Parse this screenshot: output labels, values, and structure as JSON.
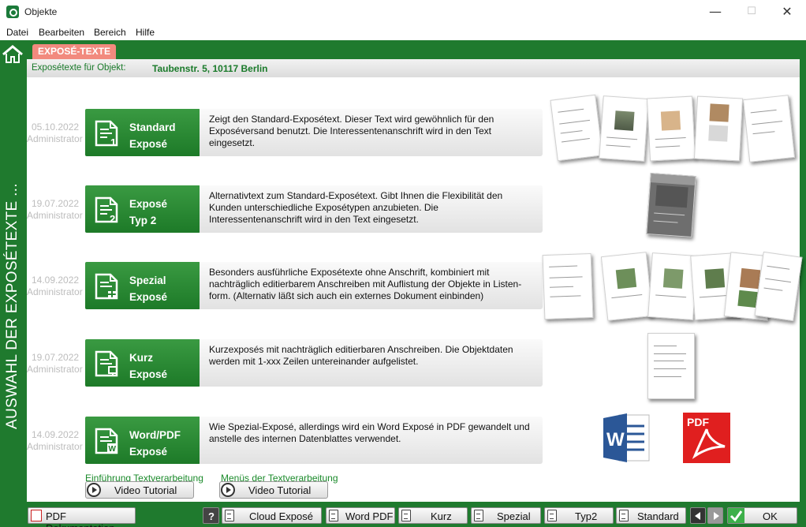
{
  "window": {
    "title": "Objekte"
  },
  "menu": [
    "Datei",
    "Bearbeiten",
    "Bereich",
    "Hilfe"
  ],
  "sidebar": {
    "vertical_title": "AUSWAHL DER EXPOSÉTEXTE ..."
  },
  "tab": {
    "label": "EXPOSÉ-TEXTE"
  },
  "object": {
    "label": "Exposétexte für Objekt:",
    "address": "Taubenstr. 5, 10117 Berlin"
  },
  "rows": [
    {
      "date": "05.10.2022",
      "user": "Administrator",
      "line1": "Standard",
      "line2": "Exposé",
      "description": "Zeigt den Standard-Exposétext. Dieser Text wird gewöhnlich für den Exposéversand benutzt. Die Interessentenanschrift wird in den Text eingesetzt.",
      "icon": "document-1-icon"
    },
    {
      "date": "19.07.2022",
      "user": "Administrator",
      "line1": "Exposé",
      "line2": "Typ 2",
      "description": "Alternativtext zum Standard-Exposétext. Gibt Ihnen die Flexibilität den Kunden unterschiedliche Exposétypen anzubieten. Die Interessentenanschrift wird in den Text eingesetzt.",
      "icon": "document-2-icon"
    },
    {
      "date": "14.09.2022",
      "user": "Administrator",
      "line1": "Spezial",
      "line2": "Exposé",
      "description": "Besonders ausführliche Exposétexte ohne Anschrift, kombiniert mit nachträglich editierbarem Anschreiben mit Auflistung der Objekte in Listen-form. (Alternativ läßt sich auch ein externes Dokument einbinden)",
      "icon": "document-list-icon"
    },
    {
      "date": "19.07.2022",
      "user": "Administrator",
      "line1": "Kurz",
      "line2": "Exposé",
      "description": "Kurzexposés mit nachträglich editierbaren Anschreiben. Die Objektdaten werden mit 1-xxx Zeilen untereinander aufgelistet.",
      "icon": "document-short-icon"
    },
    {
      "date": "14.09.2022",
      "user": "Administrator",
      "line1": "Word/PDF",
      "line2": "Exposé",
      "description": "Wie Spezial-Exposé, allerdings wird ein Word Exposé in PDF gewandelt und anstelle des internen Datenblattes verwendet.",
      "icon": "document-word-icon"
    }
  ],
  "tutorials": [
    {
      "label": "Einführung Textverarbeitung",
      "button": "Video Tutorial"
    },
    {
      "label": "Menüs der Textverarbeitung",
      "button": "Video Tutorial"
    }
  ],
  "file_icons": {
    "word": "W",
    "pdf": "PDF"
  },
  "bottom": {
    "pdf_doc": "PDF Dokumentation",
    "help": "?",
    "cloud": "Cloud Exposé",
    "wordpdf": "Word PDF",
    "kurz": "Kurz",
    "spezial": "Spezial",
    "typ2": "Typ2",
    "standard": "Standard",
    "ok": "OK"
  },
  "colors": {
    "frame": "#1f7a2e",
    "tab": "#f28a7e",
    "accent_text": "#1a7a2a"
  }
}
